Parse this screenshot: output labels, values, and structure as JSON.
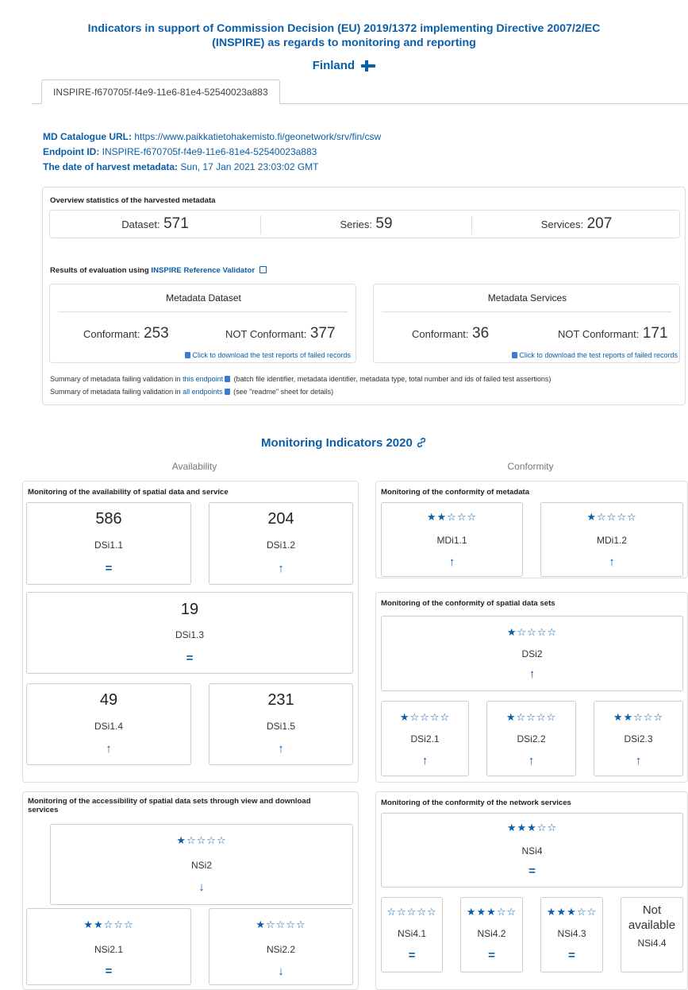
{
  "header": {
    "title_line1": "Indicators in support of Commission Decision (EU) 2019/1372 implementing Directive 2007/2/EC",
    "title_line2": "(INSPIRE) as regards to monitoring and reporting",
    "country": "Finland",
    "flag_icon": "finland-flag-icon"
  },
  "tab": {
    "label": "INSPIRE-f670705f-f4e9-11e6-81e4-52540023a883"
  },
  "meta": {
    "catalogue_label": "MD Catalogue URL:",
    "catalogue_value": "https://www.paikkatietohakemisto.fi/geonetwork/srv/fin/csw",
    "endpoint_label": "Endpoint ID:",
    "endpoint_value": "INSPIRE-f670705f-f4e9-11e6-81e4-52540023a883",
    "harvest_label": "The date of harvest metadata:",
    "harvest_value": "Sun, 17 Jan 2021 23:03:02 GMT"
  },
  "overview": {
    "title": "Overview statistics of the harvested metadata",
    "dataset_label": "Dataset:",
    "dataset_value": "571",
    "series_label": "Series:",
    "series_value": "59",
    "services_label": "Services:",
    "services_value": "207",
    "validator_prefix": "Results of evaluation using",
    "validator_link": "INSPIRE Reference Validator",
    "md_dataset": {
      "title": "Metadata Dataset",
      "conf_label": "Conformant:",
      "conf_value": "253",
      "nconf_label": "NOT Conformant:",
      "nconf_value": "377",
      "download": "Click to download the test reports of failed records"
    },
    "md_services": {
      "title": "Metadata Services",
      "conf_label": "Conformant:",
      "conf_value": "36",
      "nconf_label": "NOT Conformant:",
      "nconf_value": "171",
      "download": "Click to download the test reports of failed records"
    },
    "summary1_prefix": "Summary of metadata failing validation in",
    "summary1_link": "this endpoint",
    "summary1_suffix": "(batch file identifier, metadata identifier, metadata type, total number and ids of failed test assertions)",
    "summary2_prefix": "Summary of metadata failing validation in",
    "summary2_link": "all endpoints",
    "summary2_suffix": "(see \"readme\" sheet for details)"
  },
  "monitoring": {
    "title": "Monitoring Indicators 2020",
    "availability_head": "Availability",
    "conformity_head": "Conformity",
    "avail_card_title": "Monitoring of the availability of spatial data and service",
    "access_card_title_l1": "Monitoring of the accessibility of spatial data sets through view and download",
    "access_card_title_l2": "services",
    "conf_md_title": "Monitoring of the conformity of metadata",
    "conf_sds_title": "Monitoring of the conformity of spatial data sets",
    "conf_ns_title": "Monitoring of the conformity of the network services",
    "not_available": "Not available",
    "indicators": {
      "DSi1_1": {
        "label": "DSi1.1",
        "value": "586",
        "trend": "="
      },
      "DSi1_2": {
        "label": "DSi1.2",
        "value": "204",
        "trend": "↑"
      },
      "DSi1_3": {
        "label": "DSi1.3",
        "value": "19",
        "trend": "="
      },
      "DSi1_4": {
        "label": "DSi1.4",
        "value": "49",
        "trend": "↑"
      },
      "DSi1_5": {
        "label": "DSi1.5",
        "value": "231",
        "trend": "↑"
      },
      "NSi2": {
        "label": "NSi2",
        "stars": "★☆☆☆☆",
        "trend": "↓"
      },
      "NSi2_1": {
        "label": "NSi2.1",
        "stars": "★★☆☆☆",
        "trend": "="
      },
      "NSi2_2": {
        "label": "NSi2.2",
        "stars": "★☆☆☆☆",
        "trend": "↓"
      },
      "MDi1_1": {
        "label": "MDi1.1",
        "stars": "★★☆☆☆",
        "trend": "↑"
      },
      "MDi1_2": {
        "label": "MDi1.2",
        "stars": "★☆☆☆☆",
        "trend": "↑"
      },
      "DSi2": {
        "label": "DSi2",
        "stars": "★☆☆☆☆",
        "trend": "↑"
      },
      "DSi2_1": {
        "label": "DSi2.1",
        "stars": "★☆☆☆☆",
        "trend": "↑"
      },
      "DSi2_2": {
        "label": "DSi2.2",
        "stars": "★☆☆☆☆",
        "trend": "↑"
      },
      "DSi2_3": {
        "label": "DSi2.3",
        "stars": "★★☆☆☆",
        "trend": "↑"
      },
      "NSi4": {
        "label": "NSi4",
        "stars": "★★★☆☆",
        "trend": "="
      },
      "NSi4_1": {
        "label": "NSi4.1",
        "stars": "☆☆☆☆☆",
        "trend": "="
      },
      "NSi4_2": {
        "label": "NSi4.2",
        "stars": "★★★☆☆",
        "trend": "="
      },
      "NSi4_3": {
        "label": "NSi4.3",
        "stars": "★★★☆☆",
        "trend": "="
      },
      "NSi4_4": {
        "label": "NSi4.4"
      }
    }
  },
  "colors": {
    "accent": "#0b5ea8",
    "border": "#dddddd"
  }
}
